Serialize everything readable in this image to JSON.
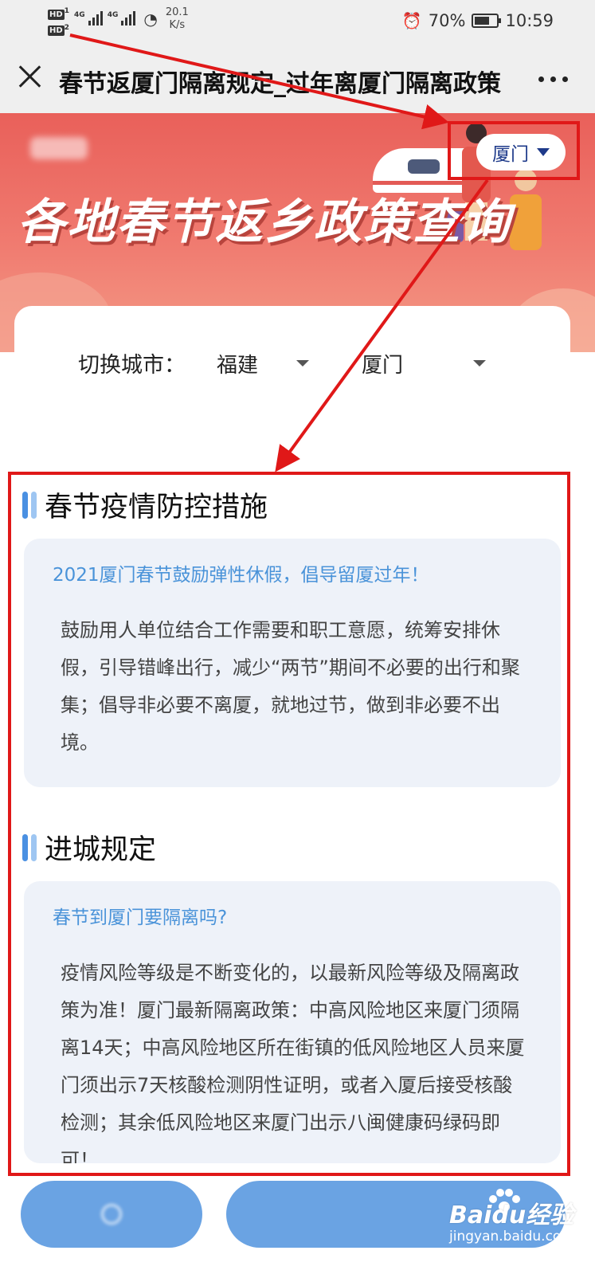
{
  "status_bar": {
    "hd1": "HD",
    "hd1_sub": "1",
    "hd2": "HD",
    "hd2_sub": "2",
    "net1": "4G",
    "net2": "4G",
    "speed_value": "20.1",
    "speed_unit": "K/s",
    "battery": "70%",
    "battery_level": 0.7,
    "time": "10:59"
  },
  "title_bar": {
    "title": "春节返厦门隔离规定_过年离厦门隔离政策"
  },
  "banner": {
    "title": "各地春节返乡政策查询",
    "city_pill": "厦门"
  },
  "selector": {
    "label": "切换城市：",
    "province": "福建",
    "city": "厦门"
  },
  "sections": [
    {
      "title": "春节疫情防控措施",
      "question": "2021厦门春节鼓励弹性休假，倡导留厦过年！",
      "answer": "鼓励用人单位结合工作需要和职工意愿，统筹安排休假，引导错峰出行，减少“两节”期间不必要的出行和聚集；倡导非必要不离厦，就地过节，做到非必要不出境。"
    },
    {
      "title": "进城规定",
      "question": "春节到厦门要隔离吗?",
      "answer": "疫情风险等级是不断变化的，以最新风险等级及隔离政策为准！厦门最新隔离政策：中高风险地区来厦门须隔离14天；中高风险地区所在街镇的低风险地区人员来厦门须出示7天核酸检测阴性证明，或者入厦后接受核酸检测；其余低风险地区来厦门出示八闽健康码绿码即可！"
    }
  ],
  "watermark": {
    "brand": "Baidu经验",
    "url": "jingyan.baidu.com"
  },
  "colors": {
    "annotation_red": "#e01818",
    "accent_blue": "#4a93d9",
    "banner_red": "#e9605a",
    "button_blue": "#6aa3e3"
  }
}
